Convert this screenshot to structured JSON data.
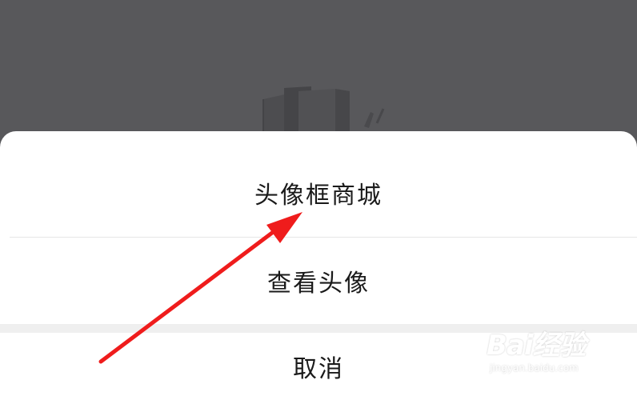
{
  "sheet": {
    "actions": [
      {
        "label": "头像框商城"
      },
      {
        "label": "查看头像"
      }
    ],
    "cancel_label": "取消"
  },
  "watermark": {
    "brand": "Bai经验",
    "url": "jingyan.baidu.com"
  },
  "colors": {
    "overlay": "#58585b",
    "sheet_bg": "#ffffff",
    "divider": "#e7e7e7",
    "gap": "#efefef",
    "arrow": "#ef1c1c",
    "text": "#1a1a1a"
  },
  "icons": {
    "background": "book-illustration-icon",
    "annotation": "red-arrow-icon",
    "watermark": "baidu-paw-icon"
  }
}
